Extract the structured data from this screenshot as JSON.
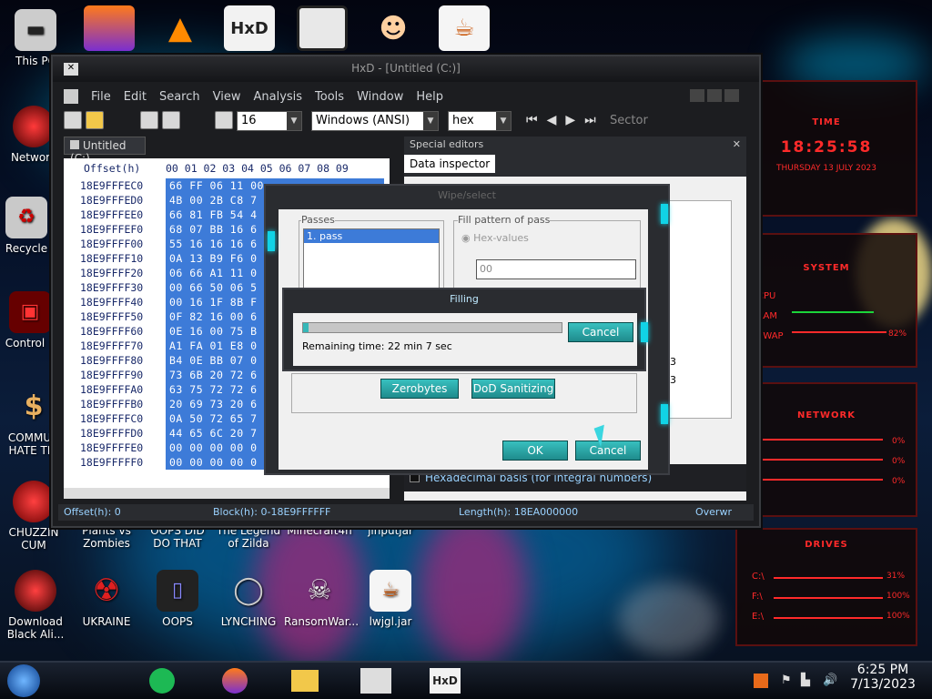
{
  "desktop": {
    "left_icons": [
      {
        "label": "This PC",
        "icon": "pc-icon"
      },
      {
        "label": "Network",
        "icon": "network-icon"
      },
      {
        "label": "Recycle",
        "icon": "recycle-icon"
      },
      {
        "label": "Control P",
        "icon": "control-panel-icon"
      },
      {
        "label": "COMMUN HATE THI",
        "icon": "money-icon"
      },
      {
        "label": "CHUZZIN CUM",
        "icon": "red-ball-icon"
      }
    ],
    "bottom_icons": [
      {
        "label": "Plants vs Zombies"
      },
      {
        "label": "OOPS DID DO THAT"
      },
      {
        "label": "The Legend of Zilda"
      },
      {
        "label": "Minecraft4n"
      },
      {
        "label": "jinputjar"
      }
    ],
    "bottom_row2": [
      {
        "label": "Download Black Ali...",
        "icon": "alien-icon"
      },
      {
        "label": "UKRAINE",
        "icon": "radiation-icon"
      },
      {
        "label": "OOPS",
        "icon": "tablet-icon"
      },
      {
        "label": "LYNCHING",
        "icon": "noose-icon"
      },
      {
        "label": "RansomWar...",
        "icon": "skull-icon"
      },
      {
        "label": "lwjgl.jar",
        "icon": "java-icon"
      }
    ],
    "top_icons": [
      "firefox-icon",
      "vlc-icon",
      "hxd-icon",
      "maze-icon",
      "doctor-icon",
      "java-icon"
    ]
  },
  "hxd": {
    "title": "HxD - [Untitled (C:)]",
    "menu": [
      "File",
      "Edit",
      "Search",
      "View",
      "Analysis",
      "Tools",
      "Window",
      "Help"
    ],
    "toolbar": {
      "bytes_per_row": "16",
      "charset": "Windows (ANSI)",
      "offset_base": "hex",
      "sector_label": "Sector"
    },
    "tab": "Untitled (C:)",
    "header_offset": "Offset(h)",
    "header_cols": "00 01 02 03 04 05 06 07 08 09",
    "rows": [
      {
        "off": "18E9FFFEC0",
        "bytes": "66 FF 06 11 00"
      },
      {
        "off": "18E9FFFED0",
        "bytes": "4B 00 2B C8 7"
      },
      {
        "off": "18E9FFFEE0",
        "bytes": "66 81 FB 54 4"
      },
      {
        "off": "18E9FFFEF0",
        "bytes": "68 07 BB 16 6"
      },
      {
        "off": "18E9FFFF00",
        "bytes": "55 16 16 16 6"
      },
      {
        "off": "18E9FFFF10",
        "bytes": "0A 13 B9 F6 0"
      },
      {
        "off": "18E9FFFF20",
        "bytes": "06 66 A1 11 0"
      },
      {
        "off": "18E9FFFF30",
        "bytes": "00 66 50 06 5"
      },
      {
        "off": "18E9FFFF40",
        "bytes": "00 16 1F 8B F"
      },
      {
        "off": "18E9FFFF50",
        "bytes": "0F 82 16 00 6"
      },
      {
        "off": "18E9FFFF60",
        "bytes": "0E 16 00 75 B"
      },
      {
        "off": "18E9FFFF70",
        "bytes": "A1 FA 01 E8 0"
      },
      {
        "off": "18E9FFFF80",
        "bytes": "B4 0E BB 07 0"
      },
      {
        "off": "18E9FFFF90",
        "bytes": "73 6B 20 72 6"
      },
      {
        "off": "18E9FFFFA0",
        "bytes": "63 75 72 72 6"
      },
      {
        "off": "18E9FFFFB0",
        "bytes": "20 69 73 20 6"
      },
      {
        "off": "18E9FFFFC0",
        "bytes": "0A 50 72 65 7"
      },
      {
        "off": "18E9FFFFD0",
        "bytes": "44 65 6C 20 7"
      },
      {
        "off": "18E9FFFFE0",
        "bytes": "00 00 00 00 0"
      },
      {
        "off": "18E9FFFFF0",
        "bytes": "00 00 00 00 0"
      }
    ],
    "special_editors": "Special editors",
    "data_inspector": "Data inspector",
    "inspector_values": [
      "43",
      "43"
    ],
    "hex_basis": "Hexadecimal basis (for integral numbers)",
    "status": {
      "offset": "Offset(h): 0",
      "block": "Block(h): 0-18E9FFFFFF",
      "length": "Length(h): 18EA000000",
      "mode": "Overwr"
    }
  },
  "wipe_dialog": {
    "title": "Wipe/select",
    "passes_label": "Passes",
    "passes": [
      "1. pass"
    ],
    "fill_label": "Fill pattern of pass",
    "hex_values": "Hex-values",
    "hex_input": "00",
    "zerobytes": "Zerobytes",
    "dod": "DoD Sanitizing",
    "ok": "OK",
    "cancel": "Cancel"
  },
  "filling_dialog": {
    "title": "Filling",
    "progress": 0.02,
    "remaining": "Remaining time: 22 min 7 sec",
    "cancel": "Cancel"
  },
  "hud": {
    "time_title": "TIME",
    "time": "18:25:58",
    "date": "THURSDAY 13 JULY 2023",
    "system_title": "SYSTEM",
    "sys_rows": [
      "CPU",
      "RAM",
      "SWAP"
    ],
    "swap_val": "82%",
    "network_title": "NETWORK",
    "net_vals": [
      "0%",
      "0%",
      "0%"
    ],
    "drives_title": "DRIVES",
    "drives": [
      {
        "name": "C:\\",
        "val": "31%"
      },
      {
        "name": "F:\\",
        "val": "100%"
      },
      {
        "name": "E:\\",
        "val": "100%"
      }
    ]
  },
  "taskbar": {
    "time": "6:25 PM",
    "date": "7/13/2023"
  },
  "colors": {
    "accent": "#11d3e6",
    "hud": "#ff2a2a",
    "selection": "#3d7bd8"
  }
}
